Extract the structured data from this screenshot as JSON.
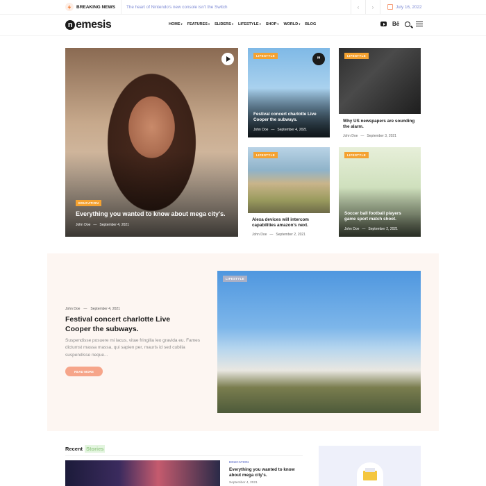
{
  "topbar": {
    "breaking_label": "BREAKING NEWS",
    "ticker": "The heart of Nintendo's new console isn't the Switch",
    "date": "July 16, 2022",
    "prev_icon": "chevron-left-icon",
    "next_icon": "chevron-right-icon"
  },
  "nav": {
    "logo_initial": "n",
    "logo_rest": "emesis",
    "menu": [
      "HOME",
      "FEATURES",
      "SLIDERS",
      "LIFESTYLE",
      "SHOP",
      "WORLD",
      "BLOG"
    ],
    "behance_label": "Bē"
  },
  "hero": {
    "main": {
      "category": "EDUCATION",
      "title": "Everything you wanted to know about mega city's.",
      "author": "John Doe",
      "date": "September 4, 2021"
    },
    "grid": [
      {
        "category": "LIFESTYLE",
        "title": "Festival concert charlotte Live Cooper the subways.",
        "author": "John Doe",
        "date": "September 4, 2021"
      },
      {
        "category": "LIFESTYLE",
        "title": "Why US newspapers are sounding the alarm.",
        "author": "John Doe",
        "date": "September 3, 2021"
      },
      {
        "category": "LIFESTYLE",
        "title": "Alexa devices will intercom capabilities amazon's next.",
        "author": "John Doe",
        "date": "September 2, 2021"
      },
      {
        "category": "LIFESTYLE",
        "title": "Soccer ball football players game sport match shoot.",
        "author": "John Doe",
        "date": "September 2, 2021"
      }
    ]
  },
  "featured": {
    "author": "John Doe",
    "date": "September 4, 2021",
    "title": "Festival concert charlotte Live Cooper the subways.",
    "excerpt": "Suspendisse posuere mi lacus, vitae fringilla leo gravida eu. Fames dictumst massa massa, qui sapien per, mauris id sed cubilia suspendisse neque...",
    "button": "READ MORE",
    "category": "LIFESTYLE"
  },
  "recent": {
    "heading_a": "Recent",
    "heading_b": "Stories",
    "category": "EDUCATION",
    "title": "Everything you wanted to know about mega city's.",
    "date": "September 4, 2021"
  }
}
